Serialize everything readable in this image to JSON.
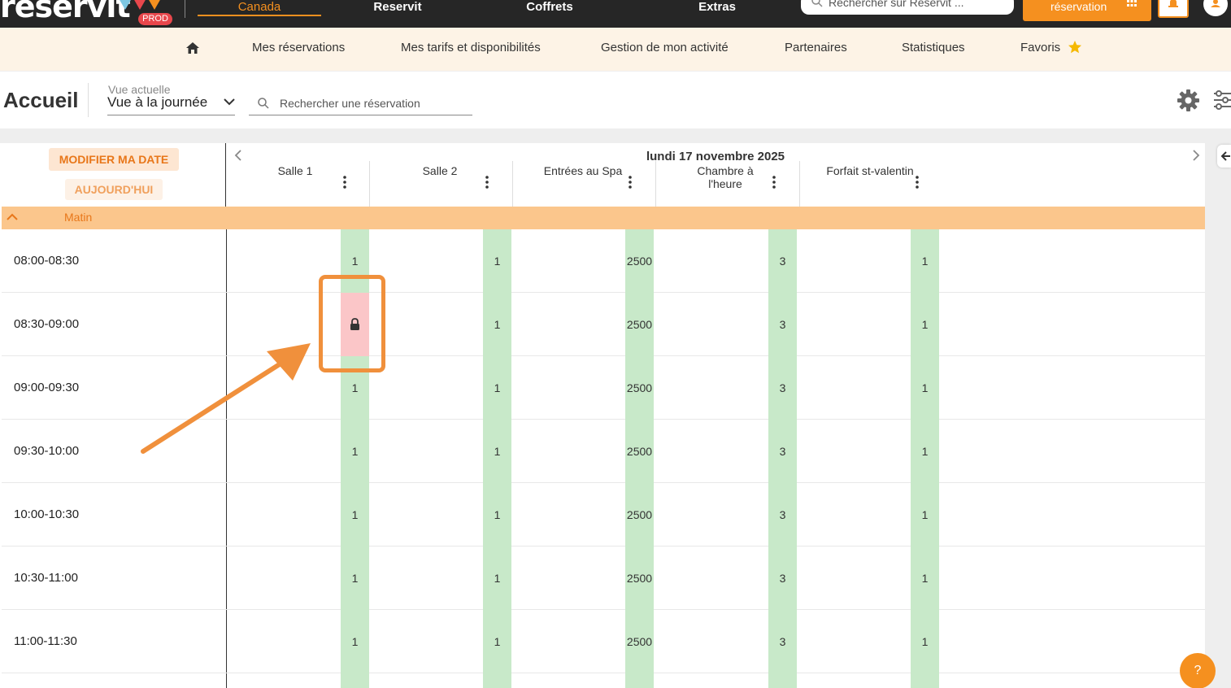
{
  "topbar": {
    "logo_text": "reservit",
    "env_badge": "PROD",
    "nav": [
      {
        "label": "Canada",
        "active": true
      },
      {
        "label": "Reservit",
        "active": false
      },
      {
        "label": "Coffrets",
        "active": false
      },
      {
        "label": "Extras",
        "active": false
      }
    ],
    "search_placeholder": "Rechercher sur Reservit ...",
    "cta_label": "réservation",
    "accent_color": "#f5901f"
  },
  "subnav": {
    "items": [
      {
        "label": "Mes réservations"
      },
      {
        "label": "Mes tarifs et disponibilités"
      },
      {
        "label": "Gestion de mon activité"
      },
      {
        "label": "Partenaires"
      },
      {
        "label": "Statistiques"
      },
      {
        "label": "Favoris"
      }
    ]
  },
  "header": {
    "title": "Accueil",
    "view_label": "Vue actuelle",
    "view_value": "Vue à la journée",
    "search_placeholder": "Rechercher une réservation"
  },
  "grid": {
    "modify_date_label": "MODIFIER MA DATE",
    "today_label": "AUJOURD'HUI",
    "date_title": "lundi 17 novembre 2025",
    "columns": [
      {
        "label": "Salle 1"
      },
      {
        "label": "Salle 2"
      },
      {
        "label": "Entrées au Spa"
      },
      {
        "label": "Chambre à l'heure"
      },
      {
        "label": "Forfait st-valentin"
      }
    ],
    "section_label": "Matin",
    "rows": [
      {
        "time": "08:00-08:30",
        "values": [
          "1",
          "1",
          "2500",
          "3",
          "1"
        ]
      },
      {
        "time": "08:30-09:00",
        "values": [
          "",
          "1",
          "2500",
          "3",
          "1"
        ]
      },
      {
        "time": "09:00-09:30",
        "values": [
          "1",
          "1",
          "2500",
          "3",
          "1"
        ]
      },
      {
        "time": "09:30-10:00",
        "values": [
          "1",
          "1",
          "2500",
          "3",
          "1"
        ]
      },
      {
        "time": "10:00-10:30",
        "values": [
          "1",
          "1",
          "2500",
          "3",
          "1"
        ]
      },
      {
        "time": "10:30-11:00",
        "values": [
          "1",
          "1",
          "2500",
          "3",
          "1"
        ]
      },
      {
        "time": "11:00-11:30",
        "values": [
          "1",
          "1",
          "2500",
          "3",
          "1"
        ]
      }
    ],
    "available_color": "#c8e9c9",
    "blocked_color": "#fbc6c8",
    "section_color": "#fbc68c"
  },
  "help": {
    "label": "?"
  }
}
